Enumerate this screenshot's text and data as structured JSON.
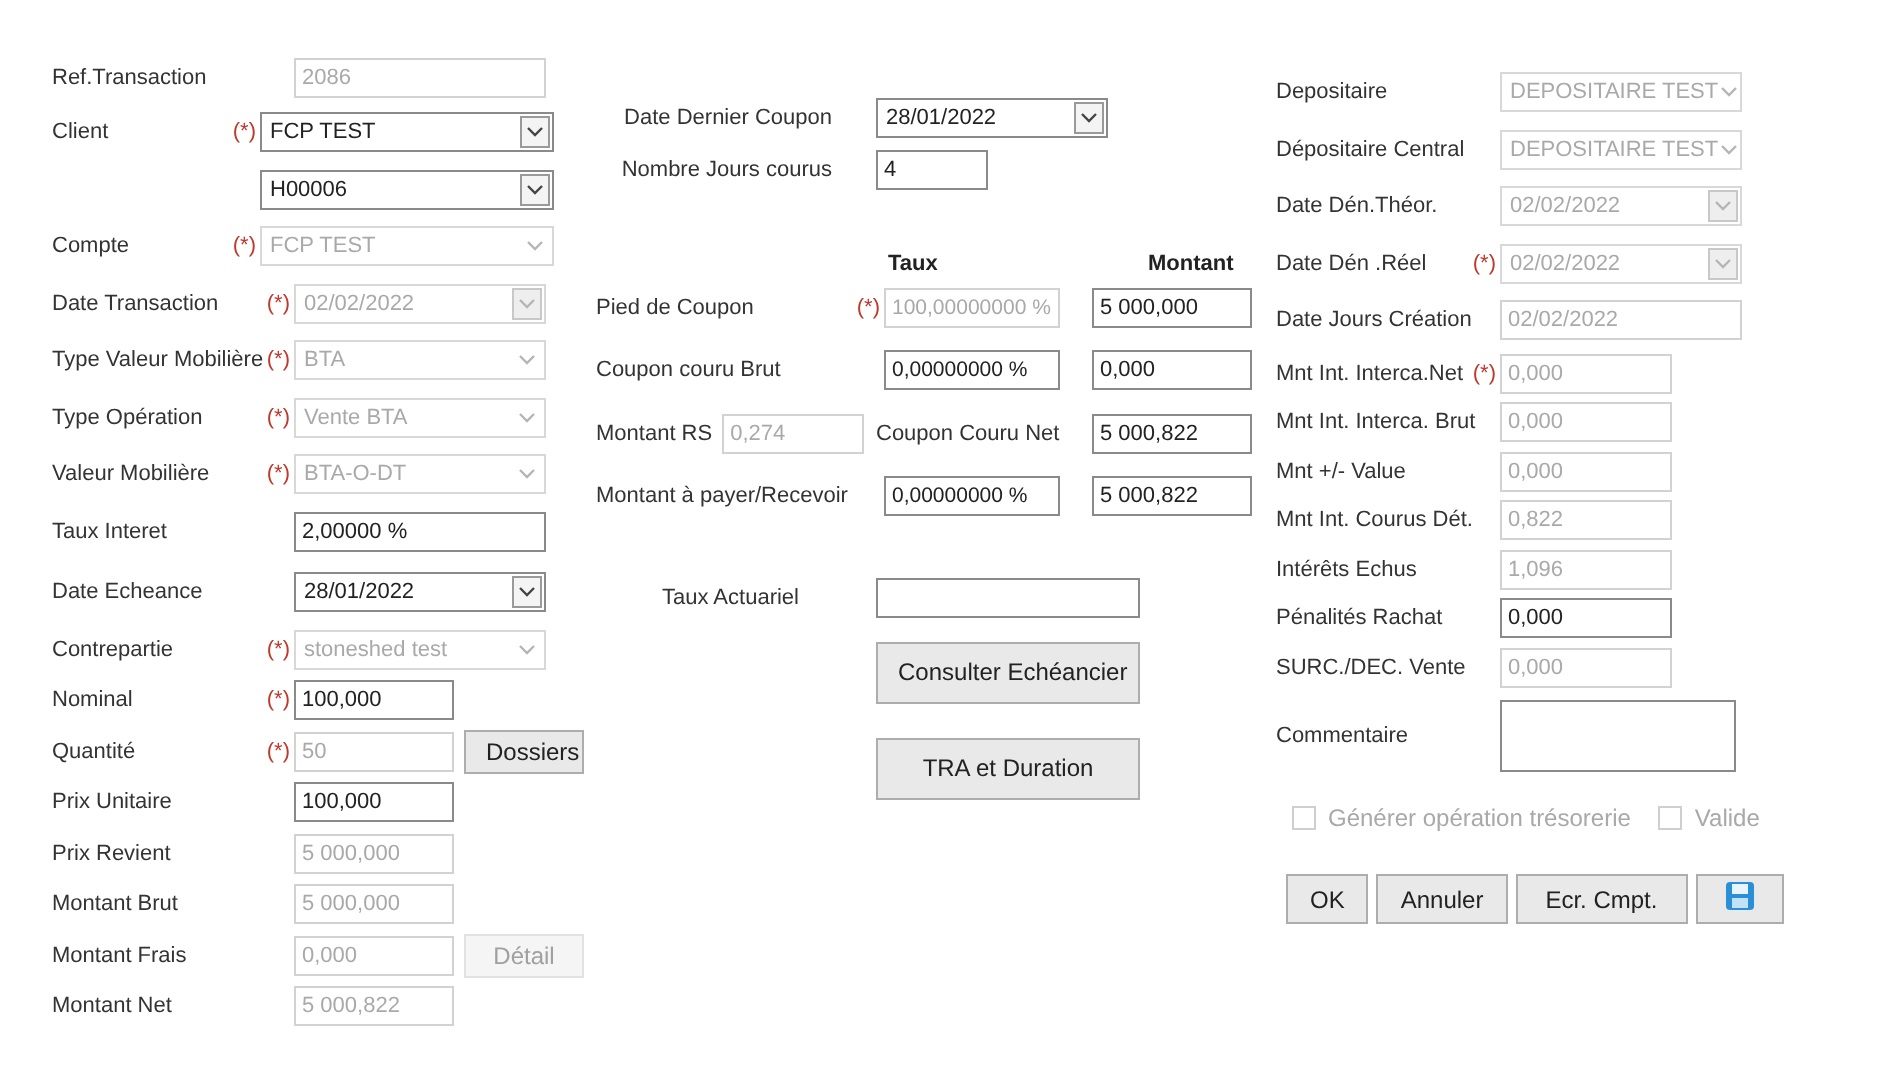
{
  "left_fields": [
    {
      "label": "Ref.Transaction",
      "kind": "text",
      "value": "2086",
      "disabled": true
    },
    {
      "label": "Client",
      "mark": "(*)",
      "kind": "select",
      "value": "FCP  TEST",
      "disabled": false
    },
    {
      "kind": "select",
      "value": "H00006",
      "disabled": false
    },
    {
      "label": "Compte",
      "mark": "(*)",
      "kind": "select",
      "value": "FCP TEST",
      "disabled": true
    },
    {
      "label": "Date Transaction",
      "mark": "(*)",
      "kind": "date",
      "value": "02/02/2022",
      "disabled": true
    },
    {
      "label": "Type Valeur Mobilière",
      "mark": "(*)",
      "kind": "select",
      "value": "BTA",
      "disabled": true
    },
    {
      "label": "Type Opération",
      "mark": "(*)",
      "kind": "select",
      "value": "Vente BTA",
      "disabled": true
    },
    {
      "label": "Valeur Mobilière",
      "mark": "(*)",
      "kind": "select",
      "value": "BTA-O-DT",
      "disabled": true
    },
    {
      "label": "Taux Interet",
      "kind": "text",
      "value": "2,00000 %",
      "disabled": false
    },
    {
      "label": "Date Echeance",
      "kind": "date",
      "value": "28/01/2022",
      "disabled": false
    },
    {
      "label": "Contrepartie",
      "mark": "(*)",
      "kind": "select",
      "value": "stoneshed test",
      "disabled": true
    },
    {
      "label": "Nominal",
      "mark": "(*)",
      "kind": "text",
      "value": "100,000",
      "disabled": false
    },
    {
      "label": "Quantité",
      "mark": "(*)",
      "kind": "text",
      "value": "50",
      "disabled": true,
      "button": {
        "label": "Dossiers",
        "disabled": false
      }
    },
    {
      "label": "Prix Unitaire",
      "kind": "text",
      "value": "100,000",
      "disabled": false
    },
    {
      "label": "Prix Revient",
      "kind": "text",
      "value": "5 000,000",
      "disabled": true
    },
    {
      "label": "Montant Brut",
      "kind": "text",
      "value": "5 000,000",
      "disabled": true
    },
    {
      "label": "Montant Frais",
      "kind": "text",
      "value": "0,000",
      "disabled": true,
      "button": {
        "label": "Détail",
        "disabled": true
      }
    },
    {
      "label": "Montant Net",
      "kind": "text",
      "value": "5 000,822",
      "disabled": true
    }
  ],
  "middle": {
    "top_fields": [
      {
        "label": "Date Dernier Coupon",
        "kind": "date",
        "value": "28/01/2022",
        "disabled": false
      },
      {
        "label": "Nombre Jours courus",
        "kind": "text",
        "value": "4",
        "disabled": false
      }
    ],
    "headers": [
      "Taux",
      "Montant"
    ],
    "coupon_rows": [
      {
        "kind": "plain",
        "label": "Pied de Coupon",
        "mark": "(*)",
        "taux": {
          "value": "100,00000000 %",
          "disabled": true
        },
        "montant": {
          "value": "5 000,000",
          "disabled": false
        }
      },
      {
        "kind": "plain",
        "label": "Coupon couru Brut",
        "taux": {
          "value": "0,00000000 %",
          "disabled": false
        },
        "montant": {
          "value": "0,000",
          "disabled": false
        }
      },
      {
        "kind": "split",
        "label": "Montant RS",
        "rs": {
          "value": "0,274",
          "disabled": true
        },
        "sub_label": "Coupon Couru Net",
        "montant": {
          "value": "5 000,822",
          "disabled": false
        }
      },
      {
        "kind": "plain",
        "label": "Montant à payer/Recevoir",
        "taux": {
          "value": "0,00000000 %",
          "disabled": false
        },
        "montant": {
          "value": "5 000,822",
          "disabled": false
        }
      }
    ],
    "taux_actuariel": {
      "label": "Taux Actuariel",
      "disabled": false
    },
    "buttons": [
      "Consulter  Echéancier",
      "TRA et Duration"
    ]
  },
  "right_fields": [
    {
      "label": "Depositaire",
      "kind": "select",
      "value": "DEPOSITAIRE TEST",
      "disabled": true
    },
    {
      "label": "Dépositaire Central",
      "kind": "select",
      "value": "DEPOSITAIRE TEST",
      "disabled": true
    },
    {
      "label": "Date Dén.Théor.",
      "kind": "date",
      "value": "02/02/2022",
      "disabled": true
    },
    {
      "label": "Date Dén .Réel",
      "mark": "(*)",
      "kind": "date",
      "value": "02/02/2022",
      "disabled": true
    },
    {
      "label": "Date Jours Création",
      "kind": "text",
      "value": "02/02/2022",
      "disabled": true
    },
    {
      "label": "Mnt Int. Interca.Net",
      "mark": "(*)",
      "kind": "text",
      "value": "0,000",
      "disabled": true
    },
    {
      "label": "Mnt Int. Interca. Brut",
      "kind": "text",
      "value": "0,000",
      "disabled": true
    },
    {
      "label": "Mnt +/- Value",
      "kind": "text",
      "value": "0,000",
      "disabled": true
    },
    {
      "label": "Mnt Int. Courus Dét.",
      "kind": "text",
      "value": "0,822",
      "disabled": true
    },
    {
      "label": "Intérêts Echus",
      "kind": "text",
      "value": "1,096",
      "disabled": true
    },
    {
      "label": "Pénalités Rachat",
      "kind": "text",
      "value": "0,000",
      "disabled": false
    },
    {
      "label": "SURC./DEC. Vente",
      "kind": "text",
      "value": "0,000",
      "disabled": true
    },
    {
      "label": "Commentaire",
      "kind": "area",
      "disabled": false
    }
  ],
  "checkboxes": [
    {
      "label": "Générer opération trésorerie",
      "checked": false,
      "disabled": true
    },
    {
      "label": "Valide",
      "checked": false,
      "disabled": true
    }
  ],
  "actions": [
    {
      "kind": "text",
      "label": "OK"
    },
    {
      "kind": "text",
      "label": "Annuler"
    },
    {
      "kind": "text",
      "label": "Ecr. Cmpt."
    },
    {
      "kind": "save"
    }
  ]
}
